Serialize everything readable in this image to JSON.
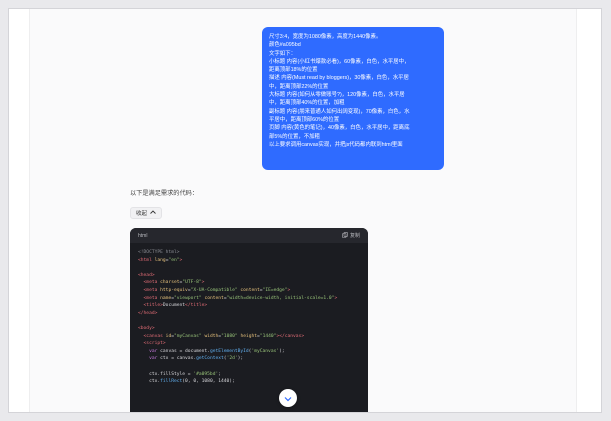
{
  "user_message": {
    "lines": [
      "尺寸3:4，宽度为1080像素，高度为1440像素。",
      "颜色#a095bd",
      "文字如下：",
      "小标题 内容(小红书爆款必看)，60像素，白色，水平居中，",
      "距离顶部18%的位置",
      "描述 内容(Must read by bloggers)，30像素，白色，水平居",
      "中，距离顶部22%的位置",
      "大标题 内容(如何从零做账号?)，120像素，白色，水平居",
      "中，距离顶部40%的位置，加粗",
      "副标题 内容(朋来普通人如何出阔变现)，70像素，白色，水",
      "平居中，距离顶部60%的位置",
      "页脚 内容(黄色的笔记)，40像素，白色，水平居中，距离底",
      "部5%的位置，不加粗",
      "以上要求调用canvas实现，并把js代码都内联到html里面"
    ]
  },
  "assistant": {
    "intro_text": "以下是满足需求的代码：",
    "collapse_label": "收起",
    "code_block": {
      "language": "html",
      "copy_label": "复制",
      "code_lines": [
        [
          {
            "t": "<!DOCTYPE html>",
            "c": "t-g"
          }
        ],
        [
          {
            "t": "<html ",
            "c": "t-tag"
          },
          {
            "t": "lang",
            "c": "t-attr"
          },
          {
            "t": "=",
            "c": "t-plain"
          },
          {
            "t": "\"en\"",
            "c": "t-str"
          },
          {
            "t": ">",
            "c": "t-tag"
          }
        ],
        [],
        [
          {
            "t": "<head>",
            "c": "t-tag"
          }
        ],
        [
          {
            "t": "  <meta ",
            "c": "t-tag"
          },
          {
            "t": "charset",
            "c": "t-attr"
          },
          {
            "t": "=",
            "c": "t-plain"
          },
          {
            "t": "\"UTF-8\"",
            "c": "t-str"
          },
          {
            "t": ">",
            "c": "t-tag"
          }
        ],
        [
          {
            "t": "  <meta ",
            "c": "t-tag"
          },
          {
            "t": "http-equiv",
            "c": "t-attr"
          },
          {
            "t": "=",
            "c": "t-plain"
          },
          {
            "t": "\"X-UA-Compatible\" ",
            "c": "t-str"
          },
          {
            "t": "content",
            "c": "t-attr"
          },
          {
            "t": "=",
            "c": "t-plain"
          },
          {
            "t": "\"IE=edge\"",
            "c": "t-str"
          },
          {
            "t": ">",
            "c": "t-tag"
          }
        ],
        [
          {
            "t": "  <meta ",
            "c": "t-tag"
          },
          {
            "t": "name",
            "c": "t-attr"
          },
          {
            "t": "=",
            "c": "t-plain"
          },
          {
            "t": "\"viewport\" ",
            "c": "t-str"
          },
          {
            "t": "content",
            "c": "t-attr"
          },
          {
            "t": "=",
            "c": "t-plain"
          },
          {
            "t": "\"width=device-width, initial-scale=1.0\"",
            "c": "t-str"
          },
          {
            "t": ">",
            "c": "t-tag"
          }
        ],
        [
          {
            "t": "  <title>",
            "c": "t-tag"
          },
          {
            "t": "Document",
            "c": "t-plain"
          },
          {
            "t": "</title>",
            "c": "t-tag"
          }
        ],
        [
          {
            "t": "</head>",
            "c": "t-tag"
          }
        ],
        [],
        [
          {
            "t": "<body>",
            "c": "t-tag"
          }
        ],
        [
          {
            "t": "  <canvas ",
            "c": "t-tag"
          },
          {
            "t": "id",
            "c": "t-attr"
          },
          {
            "t": "=",
            "c": "t-plain"
          },
          {
            "t": "\"myCanvas\" ",
            "c": "t-str"
          },
          {
            "t": "width",
            "c": "t-attr"
          },
          {
            "t": "=",
            "c": "t-plain"
          },
          {
            "t": "\"1080\" ",
            "c": "t-str"
          },
          {
            "t": "height",
            "c": "t-attr"
          },
          {
            "t": "=",
            "c": "t-plain"
          },
          {
            "t": "\"1440\"",
            "c": "t-str"
          },
          {
            "t": "></canvas>",
            "c": "t-tag"
          }
        ],
        [
          {
            "t": "  <script>",
            "c": "t-tag"
          }
        ],
        [
          {
            "t": "    var ",
            "c": "t-kw"
          },
          {
            "t": "canvas = document.",
            "c": "t-plain"
          },
          {
            "t": "getElementById",
            "c": "t-fn"
          },
          {
            "t": "(",
            "c": "t-plain"
          },
          {
            "t": "'myCanvas'",
            "c": "t-str"
          },
          {
            "t": ");",
            "c": "t-plain"
          }
        ],
        [
          {
            "t": "    var ",
            "c": "t-kw"
          },
          {
            "t": "ctx = canvas.",
            "c": "t-plain"
          },
          {
            "t": "getContext",
            "c": "t-fn"
          },
          {
            "t": "(",
            "c": "t-plain"
          },
          {
            "t": "'2d'",
            "c": "t-str"
          },
          {
            "t": ");",
            "c": "t-plain"
          }
        ],
        [],
        [
          {
            "t": "    ctx.fillStyle = ",
            "c": "t-plain"
          },
          {
            "t": "'#a095bd'",
            "c": "t-str"
          },
          {
            "t": ";",
            "c": "t-plain"
          }
        ],
        [
          {
            "t": "    ctx.",
            "c": "t-plain"
          },
          {
            "t": "fillRect",
            "c": "t-fn"
          },
          {
            "t": "(0, 0, 1080, 1440);",
            "c": "t-plain"
          }
        ]
      ]
    }
  },
  "icons": {
    "collapse": "chevron-up-icon",
    "copy": "copy-icon",
    "scroll": "chevron-down-icon"
  },
  "colors": {
    "bubble": "#2f6bff",
    "code_bg": "#1b1c21"
  }
}
